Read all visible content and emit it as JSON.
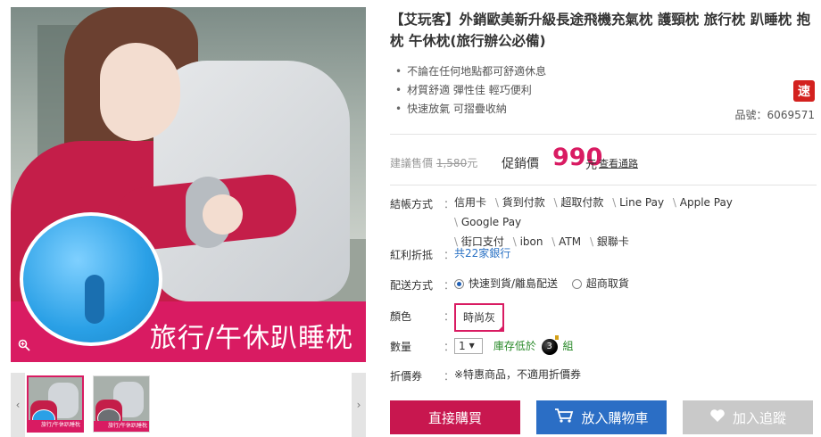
{
  "product": {
    "title": "【艾玩客】外銷歐美新升級長途飛機充氣枕 護頸枕 旅行枕 趴睡枕 抱枕 午休枕(旅行辦公必備)",
    "features": [
      "不論在任何地點都可舒適休息",
      "材質舒適 彈性佳 輕巧便利",
      "快速放氣 可摺疊收納"
    ],
    "speed_badge": "速",
    "sku": "品號：6069571"
  },
  "image": {
    "banner_text": "旅行/午休趴睡枕",
    "zoom_icon": "magnifier-icon",
    "thumb_prev": "‹",
    "thumb_next": "›",
    "thumb_banner": "旅行/午休趴睡枕"
  },
  "price": {
    "list_label": "建議售價",
    "list_price": "1,580",
    "list_unit": "元",
    "sale_label": "促銷價",
    "sale_price": "990",
    "sale_unit": "元",
    "channel_link": "查看通路"
  },
  "checkout": {
    "label": "結帳方式",
    "methods": [
      "信用卡",
      "貨到付款",
      "超取付款",
      "Line Pay",
      "Apple Pay",
      "Google Pay",
      "街口支付",
      "ibon",
      "ATM",
      "銀聯卡"
    ]
  },
  "reward": {
    "label": "紅利折抵",
    "value": "共22家銀行"
  },
  "shipping": {
    "label": "配送方式",
    "option1": "快速到貨/離島配送",
    "option2": "超商取貨",
    "selected": 1
  },
  "color": {
    "label": "顏色",
    "selected": "時尚灰"
  },
  "quantity": {
    "label": "數量",
    "value": "1",
    "stock_text": "庫存低於",
    "stock_num": "3",
    "stock_unit": "組"
  },
  "coupon": {
    "label": "折價券",
    "value": "※特惠商品，不適用折價券"
  },
  "actions": {
    "buy": "直接購買",
    "cart": "放入購物車",
    "track": "加入追蹤"
  },
  "colors": {
    "accent": "#d91b62",
    "cart_blue": "#2b6ec5",
    "link_blue": "#2870c4"
  }
}
